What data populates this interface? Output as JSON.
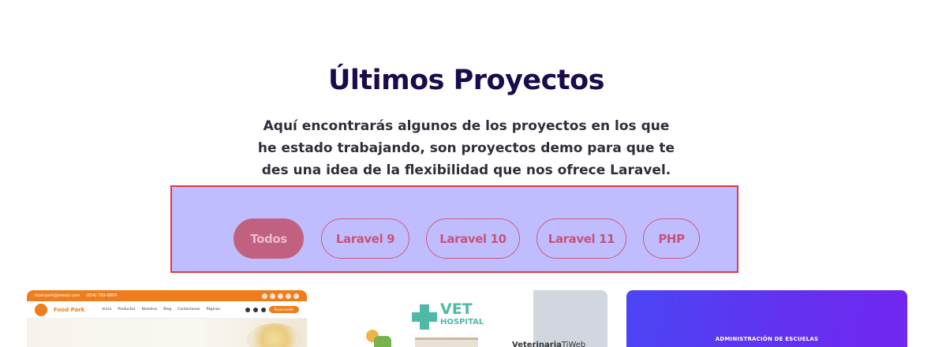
{
  "section": {
    "title": "Últimos Proyectos",
    "subtitle": "Aquí encontrarás algunos de los proyectos en los que he estado trabajando, son proyectos demo para que te des una idea de la flexibilidad que nos ofrece Laravel."
  },
  "filters": {
    "active": "Todos",
    "items": [
      {
        "label": "Todos"
      },
      {
        "label": "Laravel 9"
      },
      {
        "label": "Laravel 10"
      },
      {
        "label": "Laravel 11"
      },
      {
        "label": "PHP"
      }
    ]
  },
  "projects": [
    {
      "name": "Food Park",
      "topbar_email": "food-park@wwebi.com",
      "topbar_phone": "(654) 789-0804",
      "nav": [
        "Inicio",
        "Productos",
        "Nosotros",
        "Blog",
        "Contactanos",
        "Páginas"
      ],
      "cta": "Reservación",
      "accent": "#f07d1b"
    },
    {
      "logo_top": "VET",
      "logo_bottom": "HOSPITAL",
      "caption": "Veterinaria",
      "caption_suffix": "TiWeb",
      "accent": "#4db9a6"
    },
    {
      "caption": "ADMINISTRACIÓN DE ESCUELAS",
      "gradient_start": "#4a46f4",
      "gradient_end": "#7226f0"
    }
  ],
  "colors": {
    "title": "#1b0b4d",
    "panel_bg": "#c0bdff",
    "panel_border": "#e4363f",
    "filter_text": "#c7537a",
    "filter_active_bg": "#c2607f"
  }
}
